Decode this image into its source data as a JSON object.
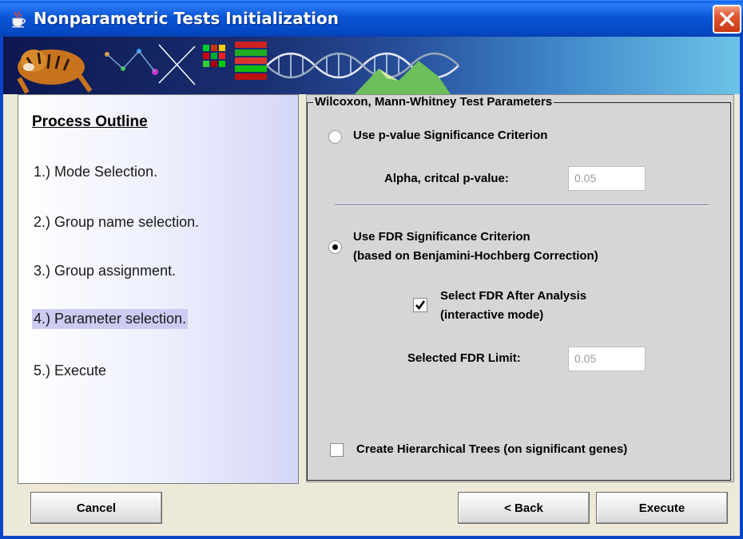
{
  "window": {
    "title": "Nonparametric Tests Initialization",
    "title_icon": "java-cup-icon",
    "close_icon": "close-icon"
  },
  "outline": {
    "title": "Process Outline",
    "steps": [
      {
        "label": "1.) Mode Selection."
      },
      {
        "label": "2.) Group name selection."
      },
      {
        "label": "3.) Group assignment."
      },
      {
        "label": "4.) Parameter selection.",
        "current": true
      },
      {
        "label": "5.) Execute"
      }
    ]
  },
  "params": {
    "group_title": "Wilcoxon, Mann-Whitney Test Parameters",
    "pvalue_radio_label": "Use p-value Significance Criterion",
    "pvalue_radio_checked": false,
    "alpha_label": "Alpha, critcal p-value:",
    "alpha_value": "0.05",
    "fdr_radio_label_line1": "Use FDR Significance Criterion",
    "fdr_radio_label_line2": "(based on Benjamini-Hochberg Correction)",
    "fdr_radio_checked": true,
    "select_fdr_label_line1": "Select FDR After Analysis",
    "select_fdr_label_line2": "(interactive mode)",
    "select_fdr_checked": true,
    "fdr_limit_label": "Selected FDR Limit:",
    "fdr_limit_value": "0.05",
    "trees_label": "Create Hierarchical Trees (on significant genes)",
    "trees_checked": false
  },
  "buttons": {
    "cancel": "Cancel",
    "back": "< Back",
    "execute": "Execute"
  },
  "colors": {
    "titlebar": "#0a55d6",
    "frame": "#0b46c7",
    "close": "#e0532d",
    "outline_highlight": "#ccccf2"
  }
}
